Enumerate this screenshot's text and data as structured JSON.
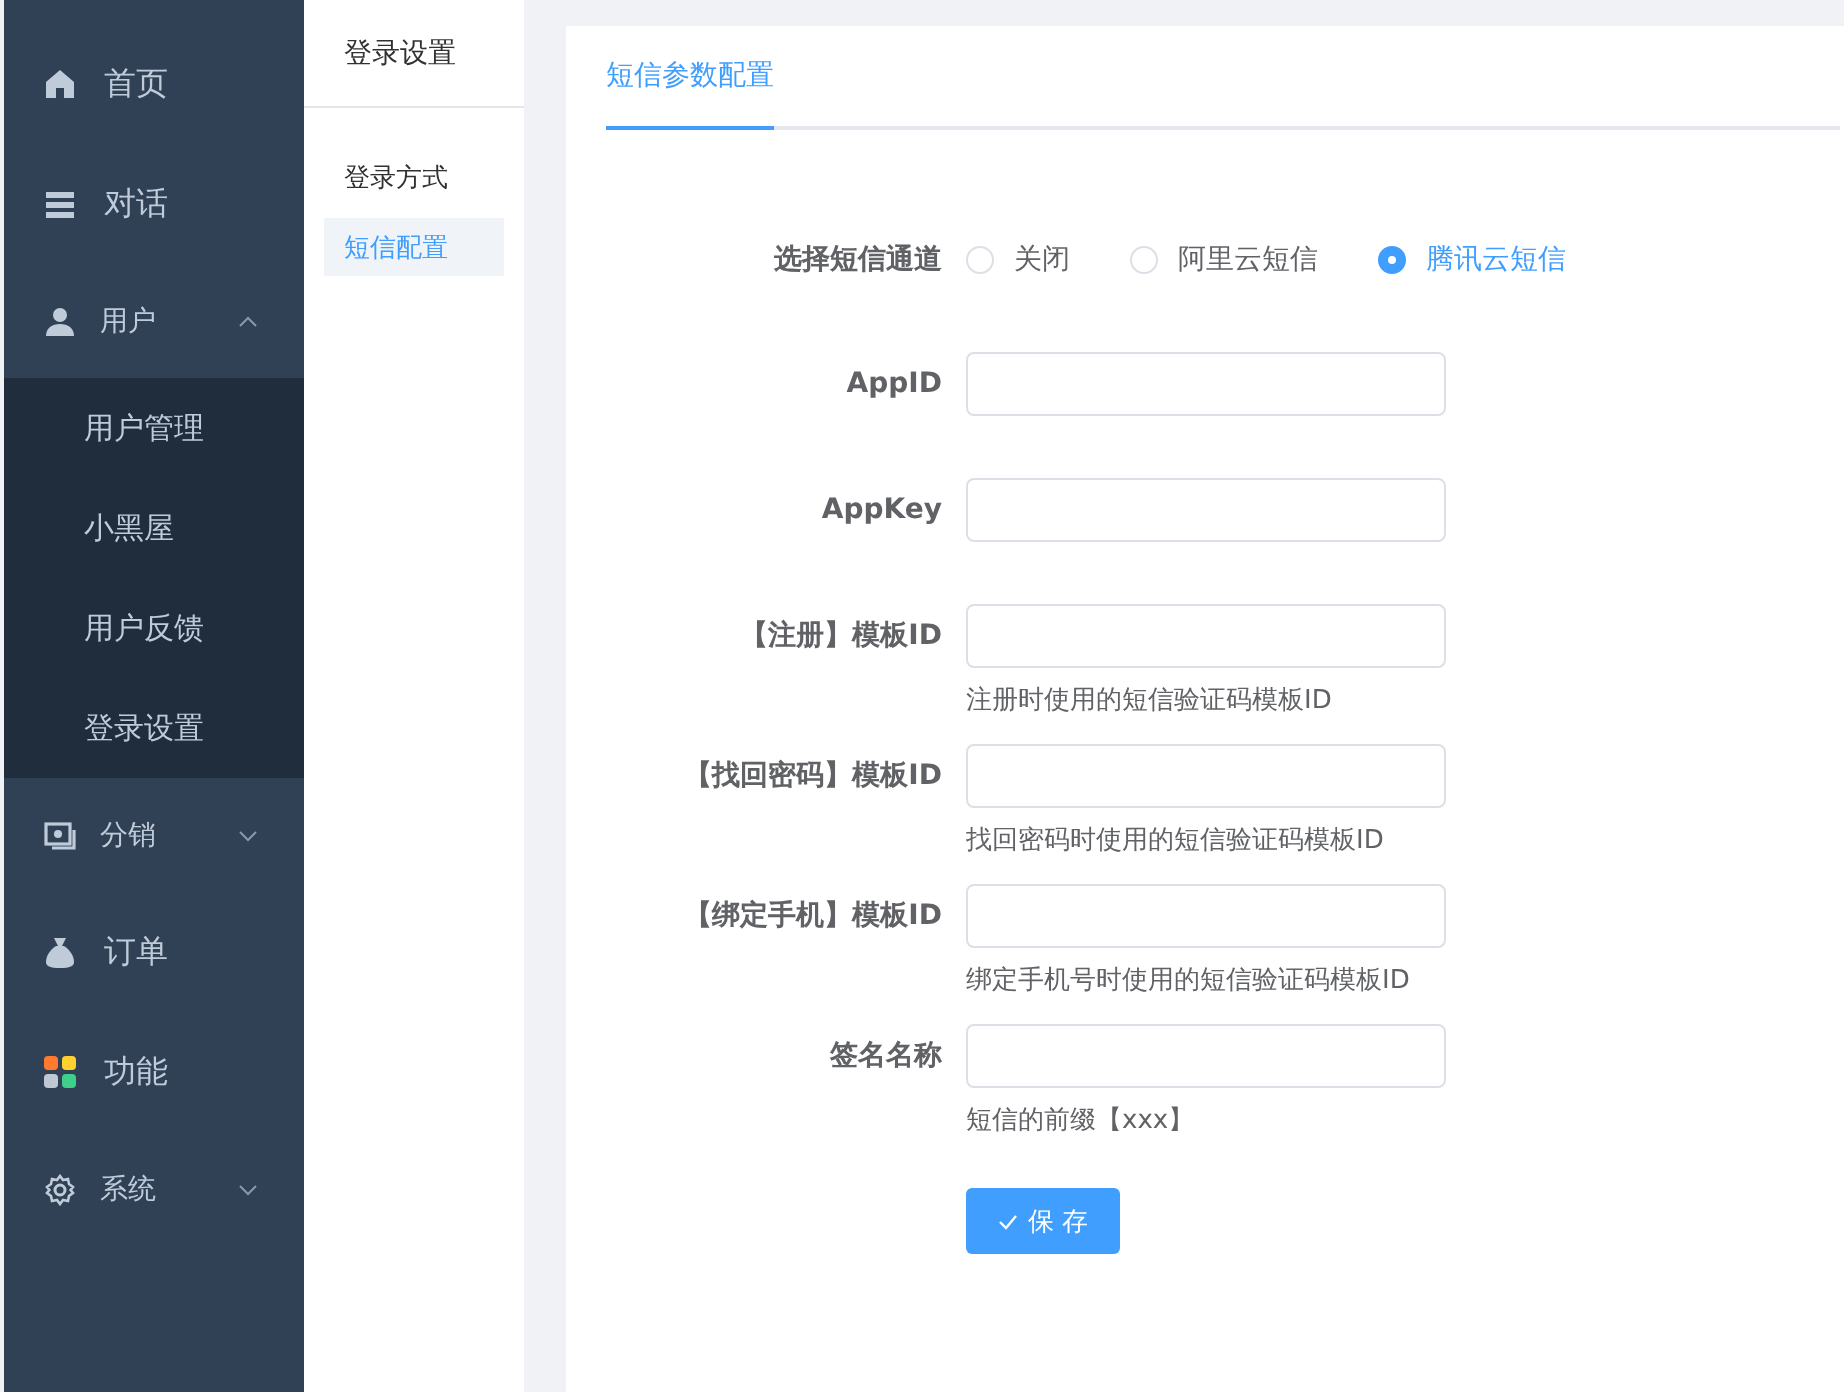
{
  "sidebar": {
    "items": [
      {
        "label": "首页"
      },
      {
        "label": "对话"
      },
      {
        "label": "用户",
        "expanded": true,
        "children": [
          {
            "label": "用户管理"
          },
          {
            "label": "小黑屋"
          },
          {
            "label": "用户反馈"
          },
          {
            "label": "登录设置"
          }
        ]
      },
      {
        "label": "分销",
        "expanded": false
      },
      {
        "label": "订单"
      },
      {
        "label": "功能"
      },
      {
        "label": "系统",
        "expanded": false
      }
    ]
  },
  "subnav": {
    "title": "登录设置",
    "items": [
      {
        "label": "登录方式",
        "selected": false
      },
      {
        "label": "短信配置",
        "selected": true
      }
    ]
  },
  "card": {
    "tabs": [
      {
        "label": "短信参数配置",
        "selected": true
      }
    ],
    "channel": {
      "label": "选择短信通道",
      "options": [
        {
          "label": "关闭",
          "selected": false
        },
        {
          "label": "阿里云短信",
          "selected": false
        },
        {
          "label": "腾讯云短信",
          "selected": true
        }
      ]
    },
    "fields": [
      {
        "label": "AppID"
      },
      {
        "label": "AppKey"
      },
      {
        "label": "【注册】模板ID",
        "help": "注册时使用的短信验证码模板ID"
      },
      {
        "label": "【找回密码】模板ID",
        "help": "找回密码时使用的短信验证码模板ID"
      },
      {
        "label": "【绑定手机】模板ID",
        "help": "绑定手机号时使用的短信验证码模板ID"
      },
      {
        "label": "签名名称",
        "help": "短信的前缀【xxx】"
      }
    ],
    "save_button": "保 存"
  }
}
